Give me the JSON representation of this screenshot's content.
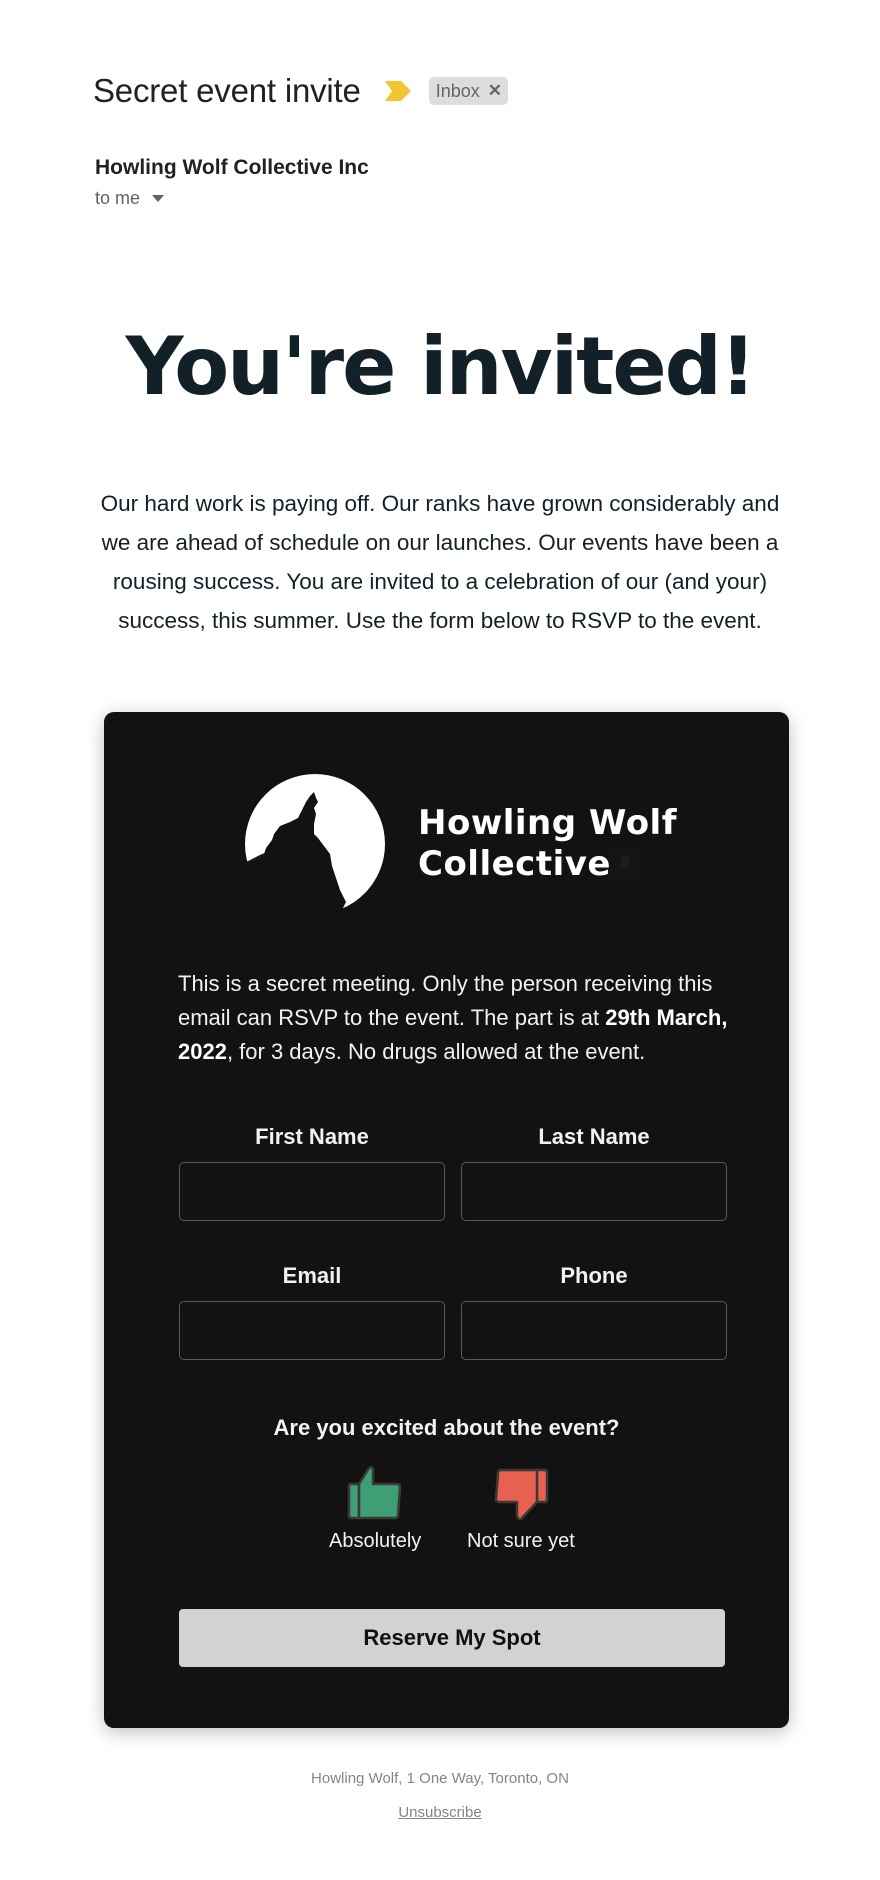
{
  "email": {
    "subject": "Secret event invite",
    "label": "Inbox",
    "label_remove": "✕",
    "important_color": "#f4c430",
    "sender": "Howling Wolf Collective Inc",
    "recipient": "to me"
  },
  "body": {
    "heading": "You're invited!",
    "intro": "Our hard work is paying off. Our ranks have grown considerably and we are ahead of schedule on our launches. Our events have been a rousing success. You are invited to a celebration of our (and your) success, this summer. Use the form below to RSVP to the event."
  },
  "card": {
    "brand_line1": "Howling Wolf",
    "brand_line2": "Collective",
    "notice_part1": "This is a secret meeting. Only the person receiving this email can RSVP to the event. The part is at ",
    "notice_date": "29th March, 2022",
    "notice_part2": ", for 3 days. No drugs allowed at the event.",
    "form": {
      "first_name_label": "First Name",
      "first_name_value": "",
      "last_name_label": "Last Name",
      "last_name_value": "",
      "email_label": "Email",
      "email_value": "",
      "phone_label": "Phone",
      "phone_value": ""
    },
    "question": "Are you excited about the event?",
    "options": [
      {
        "label": "Absolutely",
        "icon": "thumbs-up-icon",
        "color": "#3f9e74"
      },
      {
        "label": "Not sure yet",
        "icon": "thumbs-down-icon",
        "color": "#e8604f"
      }
    ],
    "submit_label": "Reserve My Spot"
  },
  "footer": {
    "address": "Howling Wolf, 1 One Way, Toronto, ON",
    "unsubscribe": "Unsubscribe"
  }
}
